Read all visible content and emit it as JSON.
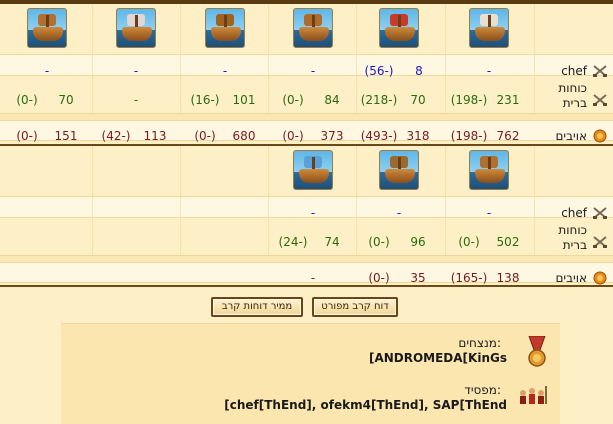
{
  "groups": [
    {
      "units": [
        {
          "name": "galleon",
          "sail_color": "#e7e0cf"
        },
        {
          "name": "fire-ship",
          "sail_color": "#c83a2a"
        },
        {
          "name": "ram-ship",
          "sail_color": "#b06a2a"
        },
        {
          "name": "mortar-ship",
          "sail_color": "#a0621f"
        },
        {
          "name": "paddle-ship",
          "sail_color": "#e0d6d6"
        },
        {
          "name": "ballista-ship",
          "sail_color": "#b07030"
        }
      ],
      "chef_label": "chef",
      "chef_values": [
        "-",
        "8",
        "-",
        "-",
        "-",
        "-"
      ],
      "chef_losses": [
        "",
        "(56-)",
        "",
        "",
        "",
        ""
      ],
      "allies_label_1": "כוחות",
      "allies_label_2": "ברית",
      "allies_values": [
        "231",
        "70",
        "84",
        "101",
        "-",
        "70"
      ],
      "allies_losses": [
        "(198-)",
        "(218-)",
        "(0-)",
        "(16-)",
        "",
        "(0-)"
      ],
      "enemies_label": "אויבים",
      "enemies_values": [
        "762",
        "318",
        "373",
        "680",
        "113",
        "151"
      ],
      "enemies_losses": [
        "(198-)",
        "(493-)",
        "(0-)",
        "(0-)",
        "(42-)",
        "(0-)"
      ]
    },
    {
      "units": [
        {
          "name": "catapult-ship",
          "sail_color": "#b07030"
        },
        {
          "name": "crane-ship",
          "sail_color": "#9a6a30"
        },
        {
          "name": "wing-ship",
          "sail_color": "#5aa0d8"
        }
      ],
      "chef_label": "chef",
      "chef_values": [
        "-",
        "-",
        "-"
      ],
      "chef_losses": [
        "",
        "",
        ""
      ],
      "allies_label_1": "כוחות",
      "allies_label_2": "ברית",
      "allies_values": [
        "502",
        "96",
        "74"
      ],
      "allies_losses": [
        "(0-)",
        "(0-)",
        "(24-)"
      ],
      "enemies_label": "אויבים",
      "enemies_values": [
        "138",
        "35",
        "-"
      ],
      "enemies_losses": [
        "(165-)",
        "(0-)",
        ""
      ]
    }
  ],
  "buttons": {
    "detailed_report": "דוח קרב מפורט",
    "convert_report": "ממיר דוחות קרב"
  },
  "result": {
    "winners_label": "מנצחים:",
    "winners_value": "[ANDROMEDA[KinGs",
    "losers_label": "מפסיד:",
    "losers_value": "[chef[ThEnd], ofekm4[ThEnd], SAP[ThEnd"
  }
}
